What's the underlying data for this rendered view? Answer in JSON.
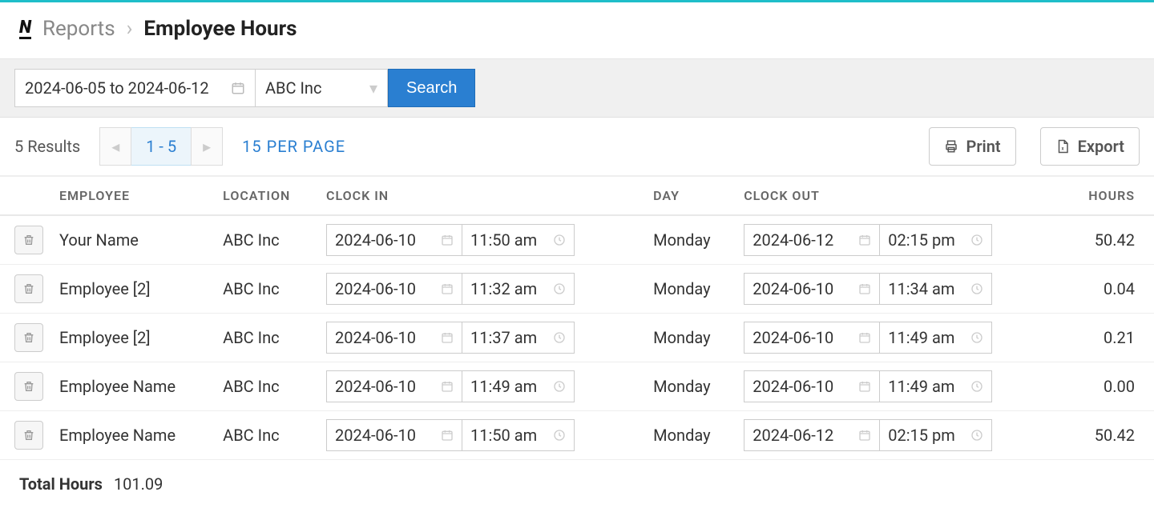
{
  "breadcrumb": {
    "parent": "Reports",
    "current": "Employee Hours"
  },
  "filters": {
    "date_range": "2024-06-05 to 2024-06-12",
    "location_selected": "ABC Inc",
    "search_label": "Search"
  },
  "meta": {
    "results_text": "5 Results",
    "page_range": "1 - 5",
    "per_page_label": "15 PER PAGE",
    "print_label": "Print",
    "export_label": "Export"
  },
  "columns": {
    "employee": "EMPLOYEE",
    "location": "LOCATION",
    "clock_in": "CLOCK IN",
    "day": "DAY",
    "clock_out": "CLOCK OUT",
    "hours": "HOURS"
  },
  "rows": [
    {
      "employee": "Your Name",
      "location": "ABC Inc",
      "in_date": "2024-06-10",
      "in_time": "11:50 am",
      "day": "Monday",
      "out_date": "2024-06-12",
      "out_time": "02:15 pm",
      "hours": "50.42"
    },
    {
      "employee": "Employee [2]",
      "location": "ABC Inc",
      "in_date": "2024-06-10",
      "in_time": "11:32 am",
      "day": "Monday",
      "out_date": "2024-06-10",
      "out_time": "11:34 am",
      "hours": "0.04"
    },
    {
      "employee": "Employee [2]",
      "location": "ABC Inc",
      "in_date": "2024-06-10",
      "in_time": "11:37 am",
      "day": "Monday",
      "out_date": "2024-06-10",
      "out_time": "11:49 am",
      "hours": "0.21"
    },
    {
      "employee": "Employee Name",
      "location": "ABC Inc",
      "in_date": "2024-06-10",
      "in_time": "11:49 am",
      "day": "Monday",
      "out_date": "2024-06-10",
      "out_time": "11:49 am",
      "hours": "0.00"
    },
    {
      "employee": "Employee Name",
      "location": "ABC Inc",
      "in_date": "2024-06-10",
      "in_time": "11:50 am",
      "day": "Monday",
      "out_date": "2024-06-12",
      "out_time": "02:15 pm",
      "hours": "50.42"
    }
  ],
  "totals": {
    "label": "Total Hours",
    "value": "101.09"
  }
}
